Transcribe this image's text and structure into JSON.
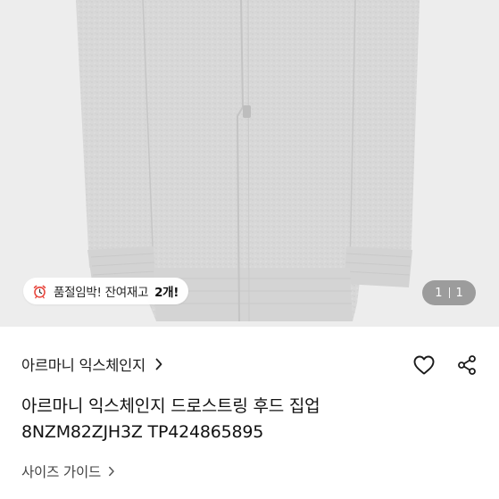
{
  "product": {
    "image_indicator": {
      "current": "1",
      "total": "1"
    },
    "stock_badge": {
      "icon": "alarm-clock-icon",
      "text": "품절임박! 잔여재고",
      "count": "2개!"
    },
    "brand": "아르마니 익스체인지",
    "title_line1": "아르마니 익스체인지 드로스트링 후드 집업",
    "title_line2": "8NZM82ZJH3Z TP424865895",
    "size_guide": "사이즈 가이드"
  },
  "icons": {
    "brand_chevron": "chevron-right-icon",
    "like": "heart-outline-icon",
    "share": "share-icon",
    "size_guide_chevron": "chevron-right-icon"
  },
  "colors": {
    "image_background": "#ededed",
    "garment": "#d9d9d9",
    "text_primary": "#111111",
    "text_secondary": "#444444",
    "badge_alarm": "#e8453c"
  }
}
